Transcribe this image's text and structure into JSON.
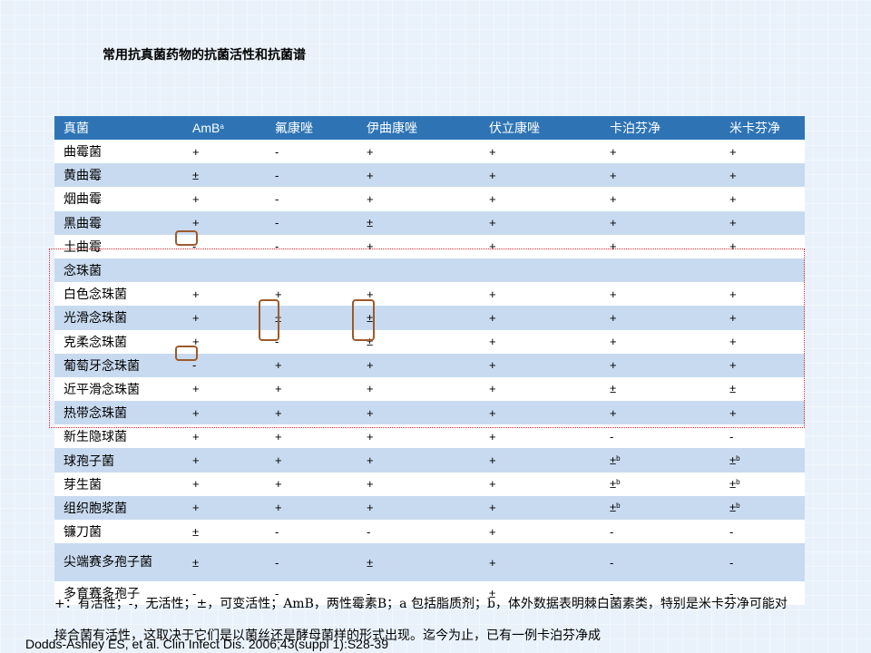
{
  "title": "常用抗真菌药物的抗菌活性和抗菌谱",
  "table": {
    "headers": [
      "真菌",
      "AmB",
      "氟康唑",
      "伊曲康唑",
      "伏立康唑",
      "卡泊芬净",
      "米卡芬净"
    ],
    "amb_superscript": "a",
    "rows": [
      {
        "name": "曲霉菌",
        "vals": [
          "+",
          "-",
          "+",
          "+",
          "+",
          "+"
        ]
      },
      {
        "name": "黄曲霉",
        "vals": [
          "±",
          "-",
          "+",
          "+",
          "+",
          "+"
        ]
      },
      {
        "name": "烟曲霉",
        "vals": [
          "+",
          "-",
          "+",
          "+",
          "+",
          "+"
        ]
      },
      {
        "name": "黑曲霉",
        "vals": [
          "+",
          "-",
          "±",
          "+",
          "+",
          "+"
        ]
      },
      {
        "name": "土曲霉",
        "vals": [
          "-",
          "-",
          "+",
          "+",
          "+",
          "+"
        ]
      },
      {
        "name": "念珠菌",
        "vals": [
          "",
          "",
          "",
          "",
          "",
          ""
        ]
      },
      {
        "name": "白色念珠菌",
        "vals": [
          "+",
          "+",
          "+",
          "+",
          "+",
          "+"
        ]
      },
      {
        "name": "光滑念珠菌",
        "vals": [
          "+",
          "±",
          "±",
          "+",
          "+",
          "+"
        ]
      },
      {
        "name": "克柔念珠菌",
        "vals": [
          "+",
          "-",
          "±",
          "+",
          "+",
          "+"
        ]
      },
      {
        "name": "葡萄牙念珠菌",
        "vals": [
          "-",
          "+",
          "+",
          "+",
          "+",
          "+"
        ]
      },
      {
        "name": "近平滑念珠菌",
        "vals": [
          "+",
          "+",
          "+",
          "+",
          "±",
          "±"
        ]
      },
      {
        "name": "热带念珠菌",
        "vals": [
          "+",
          "+",
          "+",
          "+",
          "+",
          "+"
        ]
      },
      {
        "name": "新生隐球菌",
        "vals": [
          "+",
          "+",
          "+",
          "+",
          "-",
          "-"
        ]
      },
      {
        "name": "球孢子菌",
        "vals": [
          "+",
          "+",
          "+",
          "+",
          "±",
          "±"
        ],
        "sup": [
          "",
          "",
          "",
          "",
          "b",
          "b"
        ]
      },
      {
        "name": "芽生菌",
        "vals": [
          "+",
          "+",
          "+",
          "+",
          "±",
          "±"
        ],
        "sup": [
          "",
          "",
          "",
          "",
          "b",
          "b"
        ]
      },
      {
        "name": "组织胞浆菌",
        "vals": [
          "+",
          "+",
          "+",
          "+",
          "±",
          "±"
        ],
        "sup": [
          "",
          "",
          "",
          "",
          "b",
          "b"
        ]
      },
      {
        "name": "镰刀菌",
        "vals": [
          "±",
          "-",
          "-",
          "+",
          "-",
          "-"
        ]
      },
      {
        "name": "尖端赛多孢子菌",
        "vals": [
          "±",
          "-",
          "±",
          "+",
          "-",
          "-"
        ],
        "tall": true
      },
      {
        "name": "多育赛多孢子",
        "vals": [
          "-",
          "-",
          "-",
          "±",
          "-",
          "-"
        ]
      }
    ]
  },
  "footnote": "+：有活性；-，无活性；±，可变活性；AmB，两性霉素B；a 包括脂质剂；b，体外数据表明棘白菌素类，特别是米卡芬净可能对",
  "footnote_line2": "接合菌有活性，这取决于它们是以菌丝还是酵母菌样的形式出现。迄今为止，已有一例卡泊芬净成",
  "citation": "Dodds-Ashley ES, et al. Clin Infect Dis. 2006;43(suppl 1):S28-39"
}
